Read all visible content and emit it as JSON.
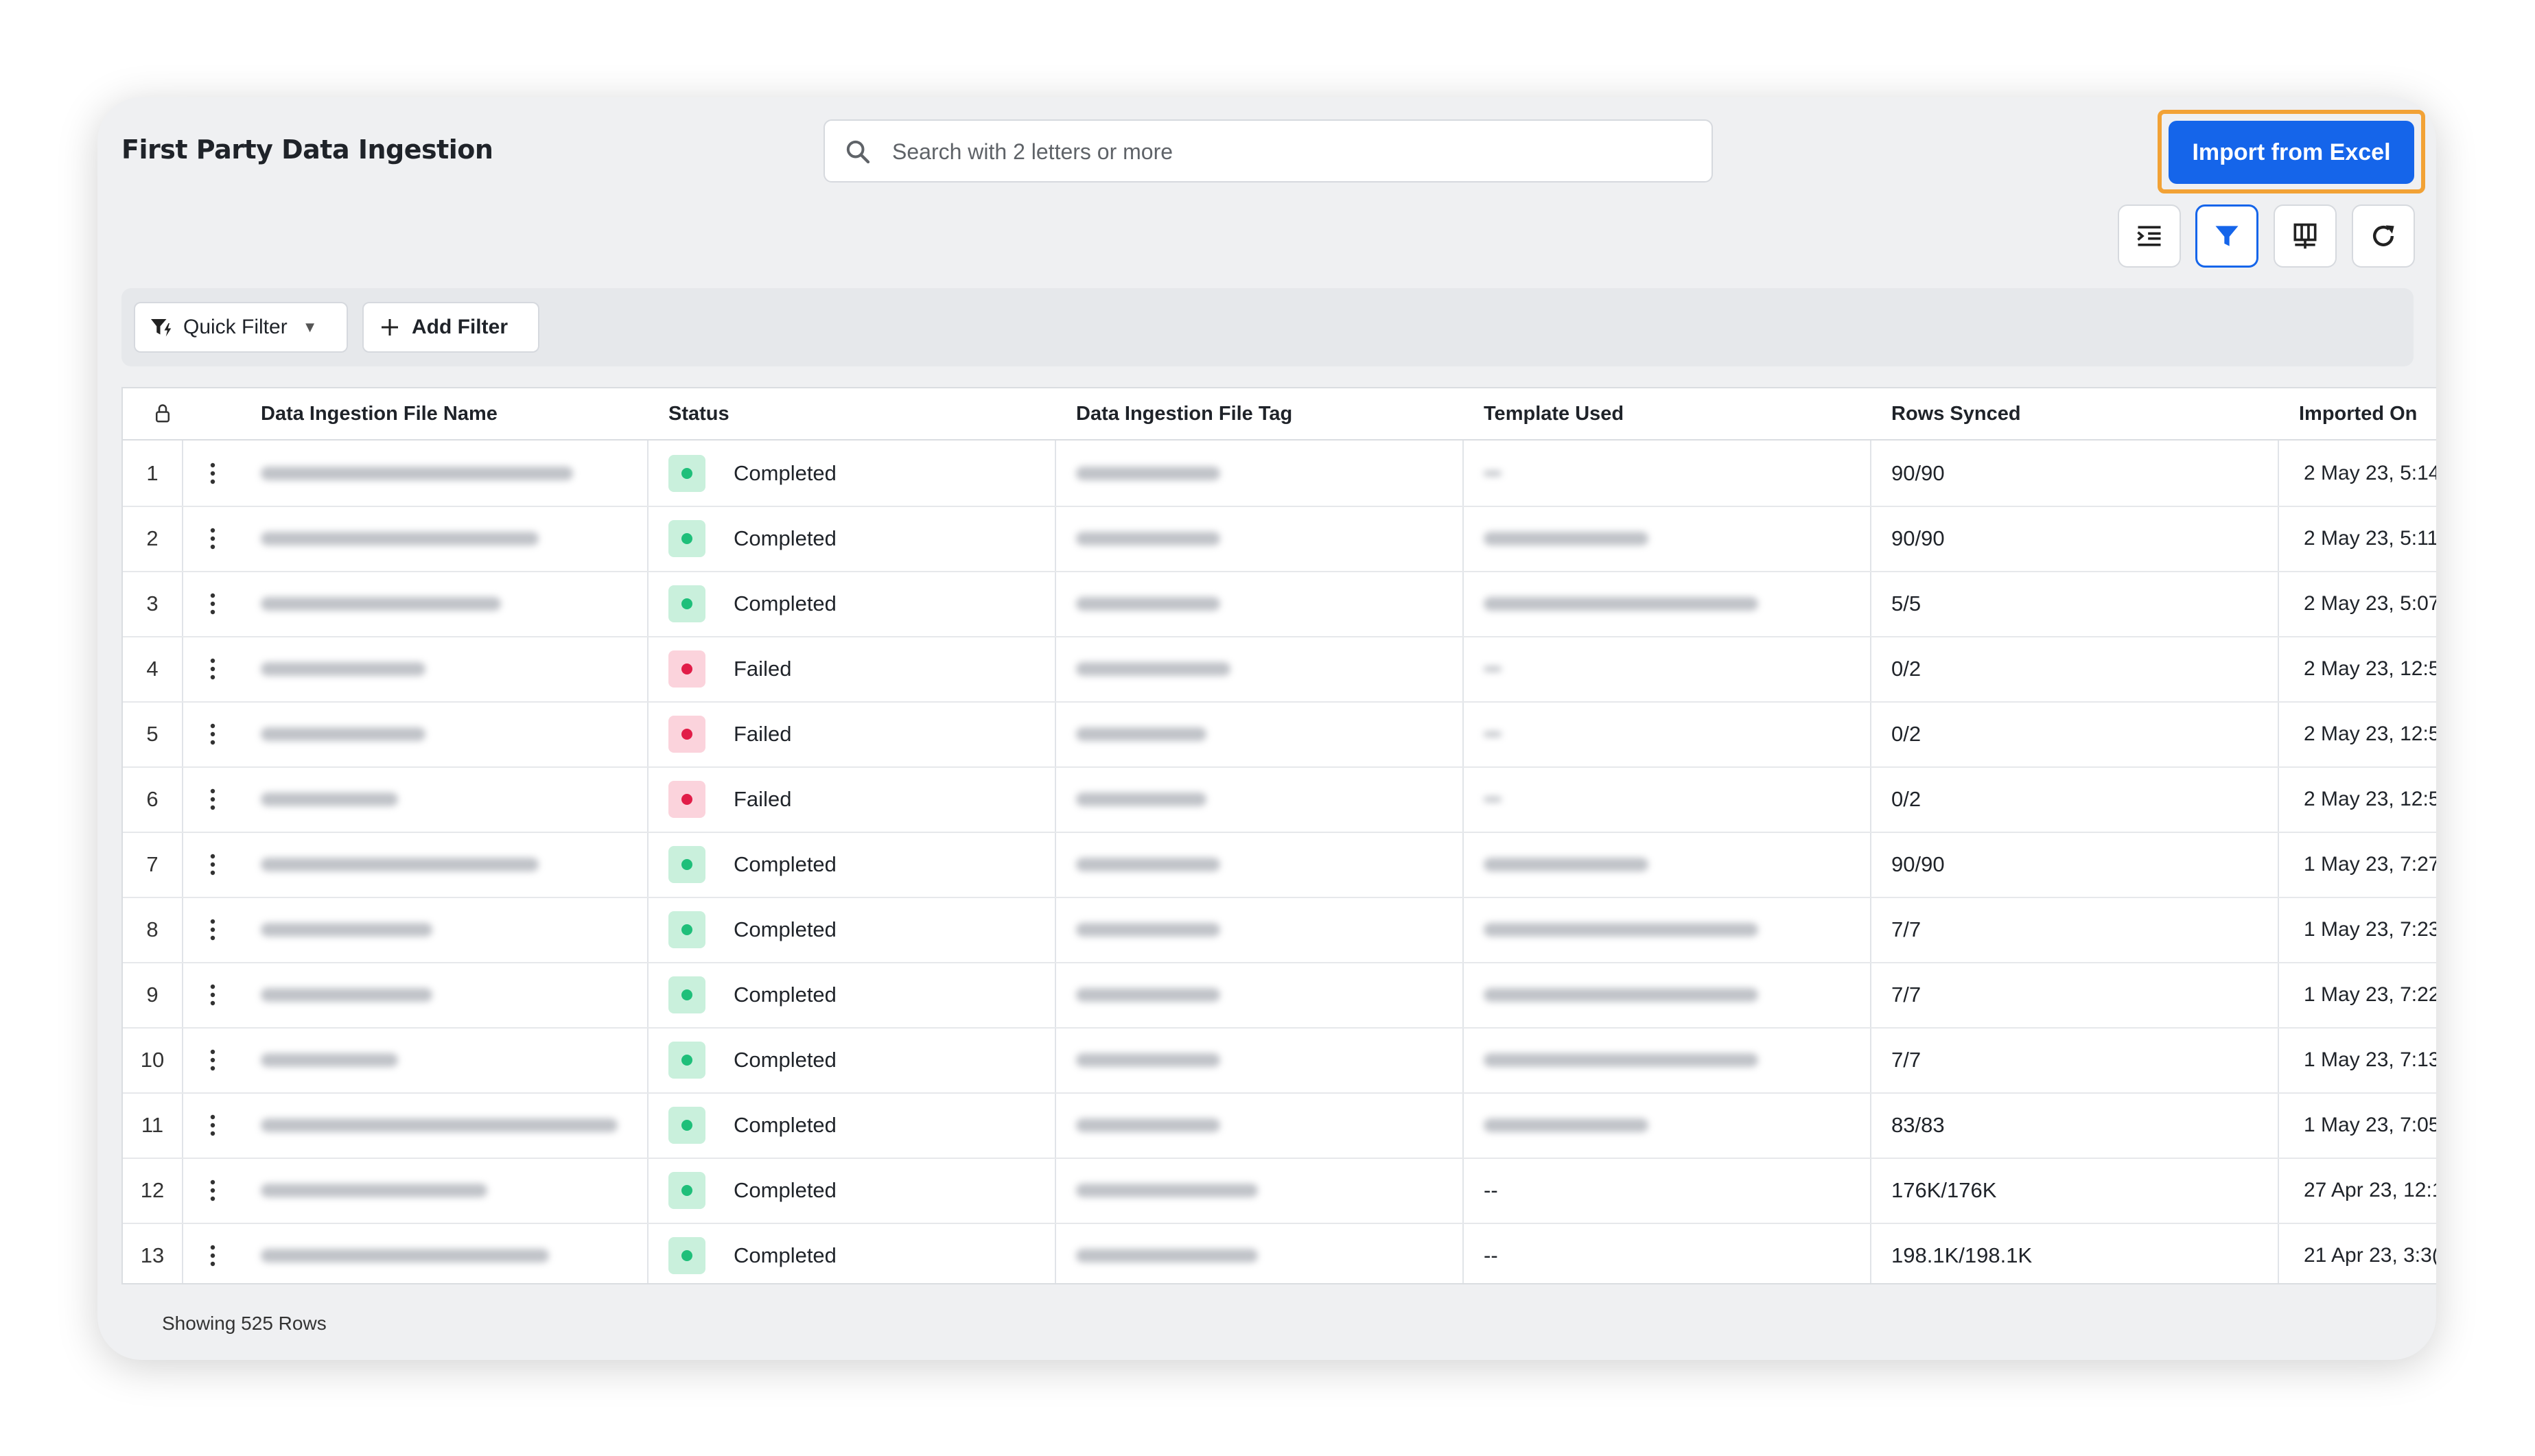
{
  "header": {
    "title": "First Party Data Ingestion",
    "search_placeholder": "Search with 2 letters or more",
    "import_label": "Import from Excel"
  },
  "toolbar": {
    "icons": [
      "indent-list-icon",
      "filter-icon",
      "columns-icon",
      "refresh-icon"
    ]
  },
  "filters": {
    "quick_filter_label": "Quick Filter",
    "add_filter_label": "Add Filter"
  },
  "table": {
    "columns": [
      "Data Ingestion File Name",
      "Status",
      "Data Ingestion File Tag",
      "Template Used",
      "Rows Synced",
      "Imported On"
    ],
    "rows": [
      {
        "num": "1",
        "status": "Completed",
        "template": "",
        "rows_synced": "90/90",
        "imported_on": "2 May 23, 5:14"
      },
      {
        "num": "2",
        "status": "Completed",
        "template": "",
        "rows_synced": "90/90",
        "imported_on": "2 May 23, 5:11"
      },
      {
        "num": "3",
        "status": "Completed",
        "template": "",
        "rows_synced": "5/5",
        "imported_on": "2 May 23, 5:07"
      },
      {
        "num": "4",
        "status": "Failed",
        "template": "",
        "rows_synced": "0/2",
        "imported_on": "2 May 23, 12:5("
      },
      {
        "num": "5",
        "status": "Failed",
        "template": "",
        "rows_synced": "0/2",
        "imported_on": "2 May 23, 12:5!"
      },
      {
        "num": "6",
        "status": "Failed",
        "template": "",
        "rows_synced": "0/2",
        "imported_on": "2 May 23, 12:5"
      },
      {
        "num": "7",
        "status": "Completed",
        "template": "",
        "rows_synced": "90/90",
        "imported_on": "1 May 23, 7:27"
      },
      {
        "num": "8",
        "status": "Completed",
        "template": "",
        "rows_synced": "7/7",
        "imported_on": "1 May 23, 7:23"
      },
      {
        "num": "9",
        "status": "Completed",
        "template": "",
        "rows_synced": "7/7",
        "imported_on": "1 May 23, 7:22"
      },
      {
        "num": "10",
        "status": "Completed",
        "template": "",
        "rows_synced": "7/7",
        "imported_on": "1 May 23, 7:13"
      },
      {
        "num": "11",
        "status": "Completed",
        "template": "",
        "rows_synced": "83/83",
        "imported_on": "1 May 23, 7:05"
      },
      {
        "num": "12",
        "status": "Completed",
        "template": "--",
        "rows_synced": "176K/176K",
        "imported_on": "27 Apr 23, 12:1"
      },
      {
        "num": "13",
        "status": "Completed",
        "template": "--",
        "rows_synced": "198.1K/198.1K",
        "imported_on": "21 Apr 23, 3:3("
      }
    ]
  },
  "footer": {
    "showing_text": "Showing 525 Rows"
  },
  "colors": {
    "accent": "#1565ea",
    "highlight_border": "#f2a236",
    "completed_bg": "#c9f0dc",
    "completed_dot": "#1fbf7a",
    "failed_bg": "#fbd3dc",
    "failed_dot": "#e11d48"
  }
}
